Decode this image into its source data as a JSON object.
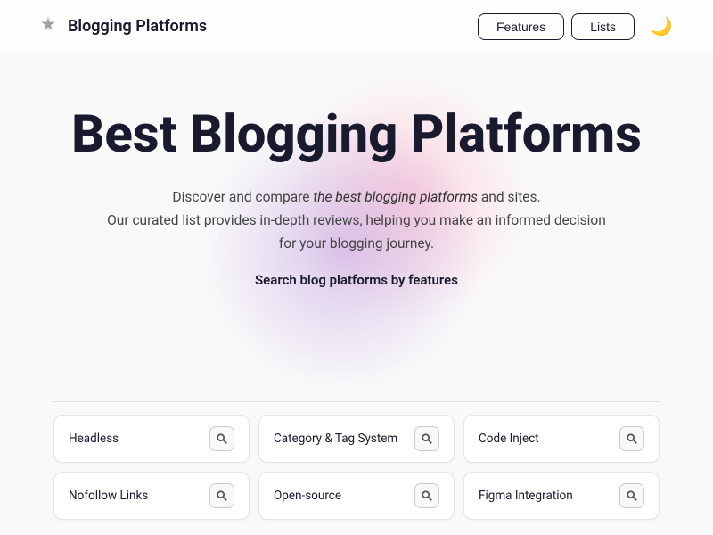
{
  "header": {
    "logo_text": "Blogging Platforms",
    "nav": {
      "features_label": "Features",
      "lists_label": "Lists"
    },
    "dark_toggle_icon": "🌙"
  },
  "hero": {
    "title": "Best Blogging Platforms",
    "subtitle_plain1": "Discover and compare ",
    "subtitle_italic": "the best blogging platforms",
    "subtitle_plain2": " and sites.",
    "subtitle_line2": "Our curated list provides in-depth reviews, helping you make an informed decision for your blogging journey.",
    "cta": "Search blog platforms by features"
  },
  "features": [
    {
      "label": "Headless"
    },
    {
      "label": "Category & Tag System"
    },
    {
      "label": "Code Inject"
    },
    {
      "label": "Nofollow Links"
    },
    {
      "label": "Open-source"
    },
    {
      "label": "Figma Integration"
    }
  ],
  "colors": {
    "accent": "#1a1a2e",
    "border": "#e5e5e5",
    "bg": "#f9f9f9"
  }
}
